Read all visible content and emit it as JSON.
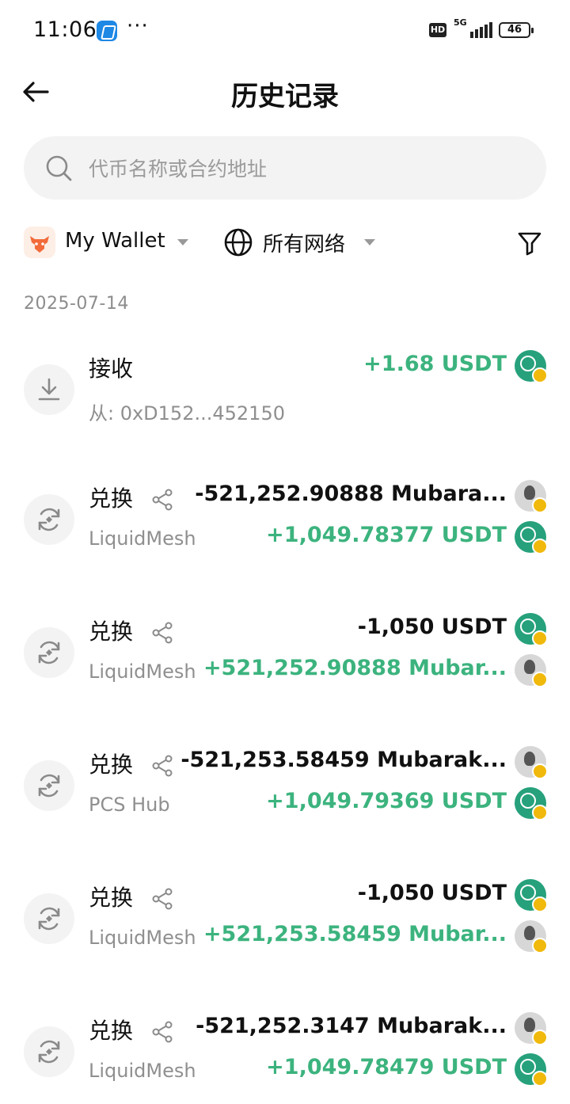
{
  "status_bar": {
    "time": "11:06",
    "dots": "···",
    "hd": "HD",
    "network_type": "5G",
    "battery": "46"
  },
  "header": {
    "title": "历史记录"
  },
  "search": {
    "placeholder": "代币名称或合约地址"
  },
  "filters": {
    "wallet": "My Wallet",
    "network": "所有网络"
  },
  "date": "2025-07-14",
  "transactions": [
    {
      "type": "接收",
      "subtitle": "从: 0xD152...452150",
      "amounts": [
        {
          "text": "+1.68 USDT",
          "token": "usdt"
        }
      ]
    },
    {
      "type": "兑换",
      "subtitle": "LiquidMesh",
      "amounts": [
        {
          "text": "-521,252.90888 Mubara...",
          "token": "mubarak"
        },
        {
          "text": "+1,049.78377 USDT",
          "token": "usdt"
        }
      ]
    },
    {
      "type": "兑换",
      "subtitle": "LiquidMesh",
      "amounts": [
        {
          "text": "-1,050 USDT",
          "token": "usdt"
        },
        {
          "text": "+521,252.90888 Mubar...",
          "token": "mubarak"
        }
      ]
    },
    {
      "type": "兑换",
      "subtitle": "PCS Hub",
      "amounts": [
        {
          "text": "-521,253.58459 Mubarak...",
          "token": "mubarak"
        },
        {
          "text": "+1,049.79369 USDT",
          "token": "usdt"
        }
      ]
    },
    {
      "type": "兑换",
      "subtitle": "LiquidMesh",
      "amounts": [
        {
          "text": "-1,050 USDT",
          "token": "usdt"
        },
        {
          "text": "+521,253.58459 Mubar...",
          "token": "mubarak"
        }
      ]
    },
    {
      "type": "兑换",
      "subtitle": "LiquidMesh",
      "amounts": [
        {
          "text": "-521,252.3147 Mubarak...",
          "token": "mubarak"
        },
        {
          "text": "+1,049.78479 USDT",
          "token": "usdt"
        }
      ]
    }
  ],
  "colors": {
    "positive": "#3cb37e",
    "negative": "#111111",
    "usdt": "#26a17b",
    "bnb_badge": "#f0b90b"
  },
  "icons": {
    "receive": "download-icon",
    "swap": "swap-icon",
    "share": "share-icon",
    "back": "arrow-left-icon",
    "search": "search-icon",
    "network": "globe-icon",
    "filter": "filter-icon"
  }
}
